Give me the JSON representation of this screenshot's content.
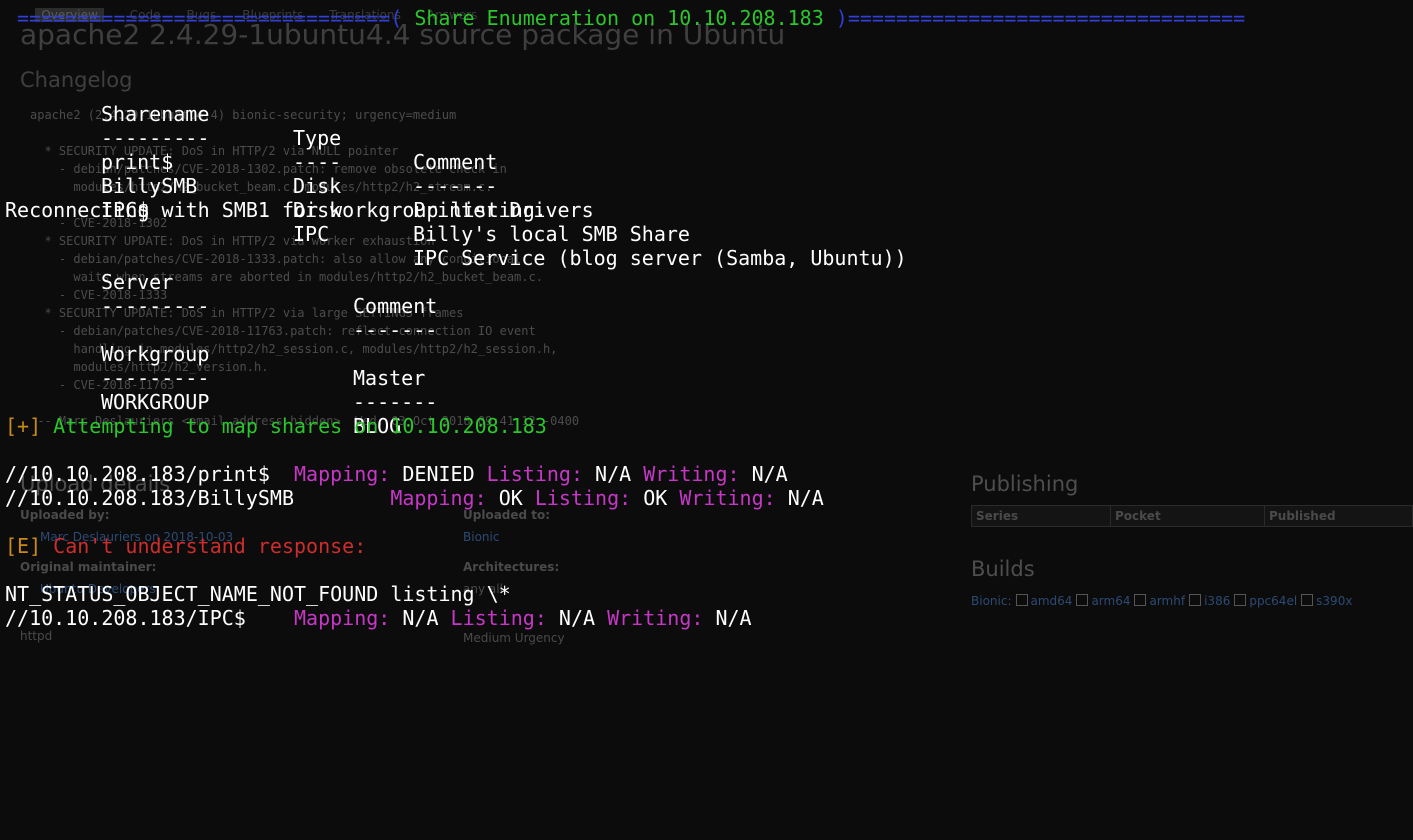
{
  "background_page": {
    "tabs": [
      "Overview",
      "Code",
      "Bugs",
      "Blueprints",
      "Translations",
      "Answers"
    ],
    "title": "apache2 2.4.29-1ubuntu4.4 source package in Ubuntu",
    "changelog_heading": "Changelog",
    "changelog_lines": [
      "apache2 (2.4.29-1ubuntu4.4) bionic-security; urgency=medium",
      "",
      "  * SECURITY UPDATE: DoS in HTTP/2 via NULL pointer",
      "    - debian/patches/CVE-2018-1302.patch: remove obsolete check in",
      "      modules/http2/h2_bucket_beam.c, modules/http2/h2_stream.c.",
      "    - CVE-2018-1302",
      "  * SECURITY UPDATE: DoS in HTTP/2 via worker exhaustion",
      "    - debian/patches/CVE-2018-1333.patch: also allow any conditional",
      "      waits when streams are aborted in modules/http2/h2_bucket_beam.c.",
      "    - CVE-2018-1333",
      "  * SECURITY UPDATE: DoS in HTTP/2 via large SETTINGS frames",
      "    - debian/patches/CVE-2018-11763.patch: reflect connection IO event",
      "      handling in modules/http2/h2_session.c, modules/http2/h2_session.h,",
      "      modules/http2/h2_version.h.",
      "    - CVE-2018-11763",
      "",
      " -- Marc Deslauriers <email address hidden>  Wed, 03 Oct 2018 09:41:12 -0400"
    ],
    "upload_heading": "Upload details",
    "uploaded_by_label": "Uploaded by:",
    "uploaded_by_value": "Marc Deslauriers on 2018-10-03",
    "original_maintainer_label": "Original maintainer:",
    "original_maintainer_value": "Ubuntu Developers",
    "section_value": "httpd",
    "uploaded_to_label": "Uploaded to:",
    "uploaded_to_value": "Bionic",
    "architectures_label": "Architectures:",
    "architectures_value": "any all",
    "urgency_value": "Medium Urgency",
    "publishing_heading": "Publishing",
    "publishing_columns": [
      "Series",
      "Pocket",
      "Published"
    ],
    "builds_heading": "Builds",
    "builds_series": "Bionic:",
    "builds_arches": [
      "amd64",
      "arm64",
      "armhf",
      "i386",
      "ppc64el",
      "s390x"
    ]
  },
  "terminal": {
    "banner_left": "===============================(",
    "banner_title": " Share Enumeration on 10.10.208.183 ",
    "banner_right": ")=================================",
    "share_headers": [
      "Sharename",
      "Type",
      "Comment"
    ],
    "share_underlines": [
      "---------",
      "----",
      "-------"
    ],
    "shares": [
      {
        "name": "print$",
        "type": "Disk",
        "comment": "Printer Drivers"
      },
      {
        "name": "BillySMB",
        "type": "Disk",
        "comment": "Billy's local SMB Share"
      },
      {
        "name": "IPC$",
        "type": "IPC",
        "comment": "IPC Service (blog server (Samba, Ubuntu))"
      }
    ],
    "reconnect_line": "Reconnecting with SMB1 for workgroup listing.",
    "server_headers": [
      "Server",
      "Comment"
    ],
    "server_underlines": [
      "---------",
      "-------"
    ],
    "workgroup_headers": [
      "Workgroup",
      "Master"
    ],
    "workgroup_underlines": [
      "---------",
      "-------"
    ],
    "workgroup_row": {
      "workgroup": "WORKGROUP",
      "master": "BLOG"
    },
    "plus_tag": "[+]",
    "attempt_line": " Attempting to map shares on 10.10.208.183",
    "labels": {
      "mapping": "Mapping:",
      "listing": "Listing:",
      "writing": "Writing:"
    },
    "map_results": [
      {
        "path": "//10.10.208.183/print$",
        "mapping": "DENIED",
        "listing": "N/A",
        "writing": "N/A"
      },
      {
        "path": "//10.10.208.183/BillySMB",
        "mapping": "OK",
        "listing": "OK",
        "writing": "N/A"
      }
    ],
    "error_tag": "[E]",
    "error_line": " Can't understand response:",
    "nt_status_line": "NT_STATUS_OBJECT_NAME_NOT_FOUND listing \\*",
    "ipc_result": {
      "path": "//10.10.208.183/IPC$",
      "mapping": "N/A",
      "listing": "N/A",
      "writing": "N/A"
    }
  }
}
